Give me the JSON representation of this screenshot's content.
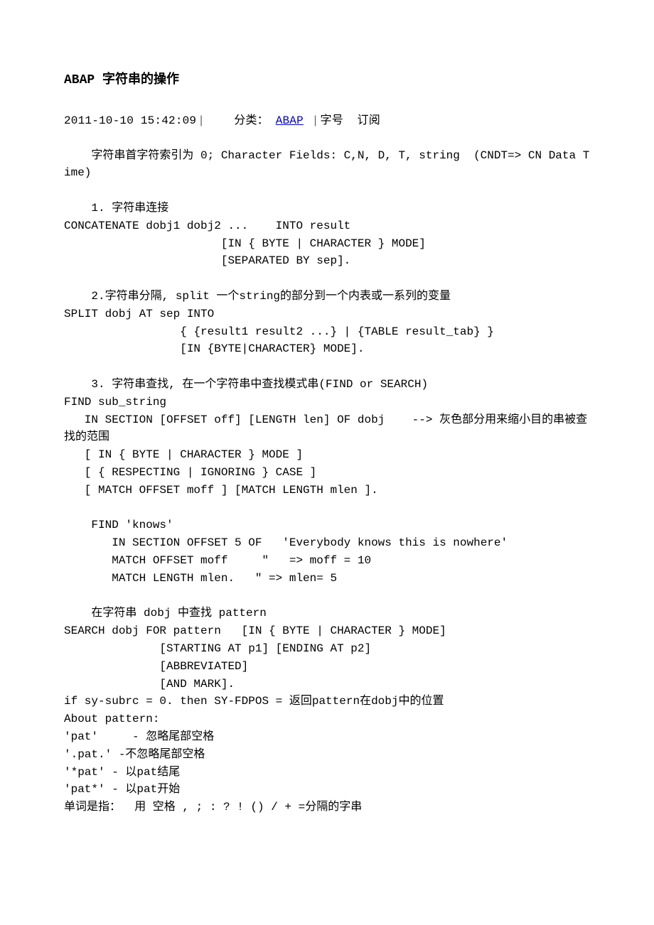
{
  "title": "ABAP 字符串的操作",
  "meta": {
    "timestamp": "2011-10-10 15:42:09",
    "category_label": "分类：",
    "category_link_text": "ABAP",
    "font_size_label": "字号",
    "subscribe_label": "订阅"
  },
  "lines": [
    "    字符串首字符索引为 0; Character Fields: C,N, D, T, string  (CNDT=> CN Data Time)",
    "",
    "    1. 字符串连接",
    "CONCATENATE dobj1 dobj2 ...    INTO result",
    "                       [IN { BYTE | CHARACTER } MODE]",
    "                       [SEPARATED BY sep].",
    "",
    "    2.字符串分隔, split 一个string的部分到一个内表或一系列的变量",
    "SPLIT dobj AT sep INTO",
    "                 { {result1 result2 ...} | {TABLE result_tab} }",
    "                 [IN {BYTE|CHARACTER} MODE].",
    "",
    "    3. 字符串查找, 在一个字符串中查找模式串(FIND or SEARCH)",
    "FIND sub_string",
    "   IN SECTION [OFFSET off] [LENGTH len] OF dobj    --> 灰色部分用来缩小目的串被查找的范围",
    "   [ IN { BYTE | CHARACTER } MODE ]",
    "   [ { RESPECTING | IGNORING } CASE ]",
    "   [ MATCH OFFSET moff ] [MATCH LENGTH mlen ].",
    "",
    "    FIND 'knows'",
    "       IN SECTION OFFSET 5 OF   'Everybody knows this is nowhere'",
    "       MATCH OFFSET moff     \"   => moff = 10",
    "       MATCH LENGTH mlen.   \" => mlen= 5",
    "",
    "    在字符串 dobj 中查找 pattern",
    "SEARCH dobj FOR pattern   [IN { BYTE | CHARACTER } MODE]",
    "              [STARTING AT p1] [ENDING AT p2]",
    "              [ABBREVIATED]",
    "              [AND MARK].",
    "if sy-subrc = 0. then SY-FDPOS = 返回pattern在dobj中的位置",
    "About pattern:",
    "'pat'     - 忽略尾部空格",
    "'.pat.' -不忽略尾部空格",
    "'*pat' - 以pat结尾",
    "'pat*' - 以pat开始",
    "单词是指：  用 空格 , ; : ? ! () / + =分隔的字串"
  ]
}
